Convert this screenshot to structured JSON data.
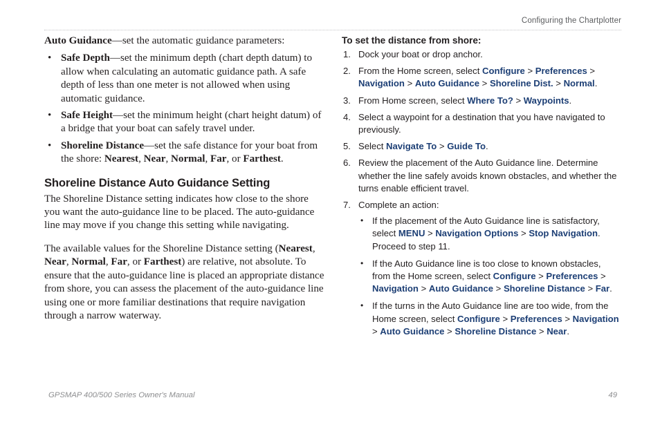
{
  "header": {
    "title": "Configuring the Chartplotter"
  },
  "left_column": {
    "lead": {
      "term": "Auto Guidance",
      "rest": "—set the automatic guidance parameters:"
    },
    "bullets": [
      {
        "bullet": "•",
        "term": "Safe Depth",
        "rest": "—set the minimum depth (chart depth datum) to allow when calculating an automatic guidance path. A safe depth of less than one meter is not allowed when using automatic guidance."
      },
      {
        "bullet": "•",
        "term": "Safe Height",
        "rest": "—set the minimum height (chart height datum) of a bridge that your boat can safely travel under."
      },
      {
        "bullet": "•",
        "term": "Shoreline Distance",
        "rest_a": "—set the safe distance for your boat from the shore: ",
        "v1": "Nearest",
        "sep1": ", ",
        "v2": "Near",
        "sep2": ", ",
        "v3": "Normal",
        "sep3": ", ",
        "v4": "Far",
        "sep4": ", or ",
        "v5": "Farthest",
        "rest_b": "."
      }
    ],
    "section_heading": "Shoreline Distance Auto Guidance Setting",
    "para1": "The Shoreline Distance setting indicates how close to the shore you want the auto-guidance line to be placed. The auto-guidance line may move if you change this setting while navigating.",
    "para2": {
      "a": "The available values for the Shoreline Distance setting (",
      "v1": "Nearest",
      "s1": ", ",
      "v2": "Near",
      "s2": ", ",
      "v3": "Normal",
      "s3": ", ",
      "v4": "Far",
      "s4": ", or ",
      "v5": "Farthest",
      "b": ") are relative, not absolute. To ensure that the auto-guidance line is placed an appropriate distance from shore, you can assess the placement of the auto-guidance line using one or more familiar destinations that require navigation through a narrow waterway."
    }
  },
  "right_column": {
    "procedure_title": "To set the distance from shore:",
    "steps": [
      {
        "num": "1.",
        "text": "Dock your boat or drop anchor."
      },
      {
        "num": "2.",
        "a": "From the Home screen, select ",
        "ui1": "Configure",
        "g1": " > ",
        "ui2": "Preferences",
        "g2": " > ",
        "ui3": "Navigation",
        "g3": " > ",
        "ui4": "Auto Guidance",
        "g4": " > ",
        "ui5": "Shoreline Dist.",
        "g5": " > ",
        "ui6": "Normal",
        "b": "."
      },
      {
        "num": "3.",
        "a": "From Home screen, select ",
        "ui1": "Where To?",
        "g1": " > ",
        "ui2": "Waypoints",
        "b": "."
      },
      {
        "num": "4.",
        "text": "Select a waypoint for a destination that you have navigated to previously."
      },
      {
        "num": "5.",
        "a": "Select ",
        "ui1": "Navigate To",
        "g1": " > ",
        "ui2": "Guide To",
        "b": "."
      },
      {
        "num": "6.",
        "text": "Review the placement of the Auto Guidance line. Determine whether the line safely avoids known obstacles, and whether the turns enable efficient travel."
      },
      {
        "num": "7.",
        "text": "Complete an action:"
      }
    ],
    "substeps": [
      {
        "bullet": "•",
        "a": "If the placement of the Auto Guidance line is satisfactory, select ",
        "ui1": "MENU",
        "g1": " > ",
        "ui2": "Navigation Options",
        "g2": " > ",
        "ui3": "Stop Navigation",
        "b": ". Proceed to step 11."
      },
      {
        "bullet": "•",
        "a": "If the Auto Guidance line is too close to known obstacles, from the Home screen, select ",
        "ui1": "Configure",
        "g1": " > ",
        "ui2": "Preferences",
        "g2": " > ",
        "ui3": "Navigation",
        "g3": " > ",
        "ui4": "Auto Guidance",
        "g4": " > ",
        "ui5": "Shoreline Distance",
        "g5": " > ",
        "ui6": "Far",
        "b": "."
      },
      {
        "bullet": "•",
        "a": "If the turns in the Auto Guidance line are too wide, from the Home screen, select ",
        "ui1": "Configure",
        "g1": " > ",
        "ui2": "Preferences",
        "g2": " > ",
        "ui3": "Navigation",
        "g3": " > ",
        "ui4": "Auto Guidance",
        "g4": " > ",
        "ui5": "Shoreline Distance",
        "g5": " > ",
        "ui6": "Near",
        "b": "."
      }
    ]
  },
  "footer": {
    "manual": "GPSMAP 400/500 Series Owner's Manual",
    "page": "49"
  },
  "colors": {
    "ui_term_blue": "#1d3f75",
    "body_text": "#231f20",
    "header_gray": "#5c5d5f",
    "footer_gray": "#8d8e90",
    "rule": "#c4c4c6"
  }
}
